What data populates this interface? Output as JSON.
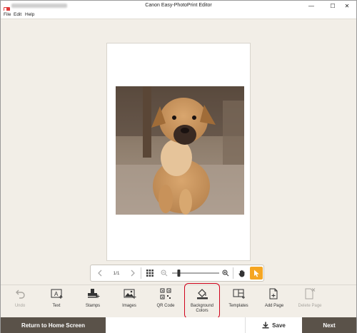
{
  "window": {
    "title": "Canon Easy-PhotoPrint Editor",
    "minimize_glyph": "—",
    "maximize_glyph": "☐",
    "close_glyph": "✕"
  },
  "menu": {
    "items": [
      "File",
      "Edit",
      "Help"
    ]
  },
  "zoom_bar": {
    "page_indicator": "1/1",
    "zoom_level_fraction": 0.12
  },
  "toolbar": {
    "tools": [
      {
        "label": "Undo",
        "icon": "undo-icon",
        "enabled": false
      },
      {
        "label": "Text",
        "icon": "text-icon",
        "enabled": true
      },
      {
        "label": "Stamps",
        "icon": "stamp-icon",
        "enabled": true
      },
      {
        "label": "Images",
        "icon": "images-icon",
        "enabled": true
      },
      {
        "label": "QR Code",
        "icon": "qr-code-icon",
        "enabled": true
      },
      {
        "label": "Background\nColors",
        "icon": "paint-bucket-icon",
        "enabled": true,
        "highlighted": true
      },
      {
        "label": "Templates",
        "icon": "templates-icon",
        "enabled": true
      },
      {
        "label": "Add Page",
        "icon": "add-page-icon",
        "enabled": true
      },
      {
        "label": "Delete Page",
        "icon": "delete-page-icon",
        "enabled": false
      }
    ]
  },
  "bottom": {
    "home_label": "Return to Home Screen",
    "save_label": "Save",
    "next_label": "Next"
  },
  "colors": {
    "accent": "#f5a623",
    "highlight": "#d0021b",
    "dark_button": "#5a5249",
    "background": "#f2eee7"
  }
}
